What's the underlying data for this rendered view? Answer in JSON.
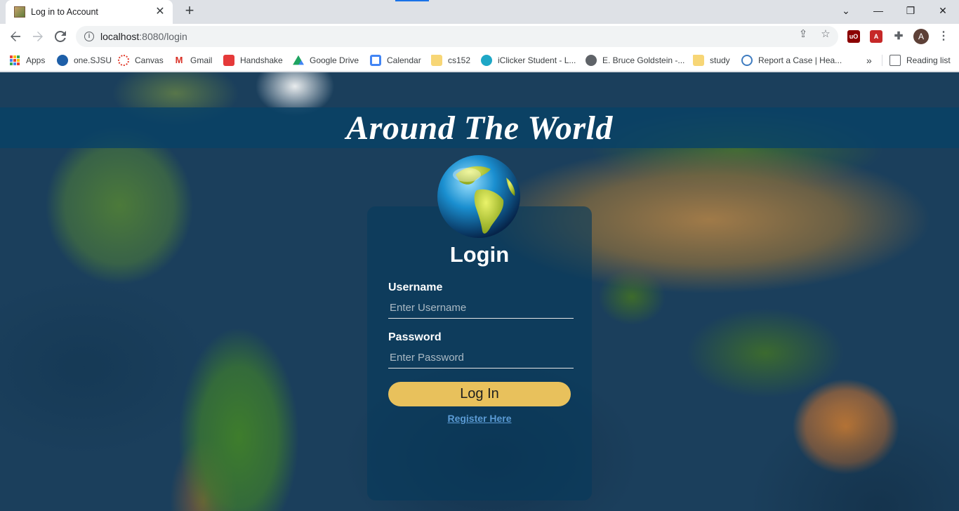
{
  "browser": {
    "tab_title": "Log in to Account",
    "tab_close": "✕",
    "new_tab": "+",
    "window_controls": {
      "collapse": "⌄",
      "minimize": "—",
      "restore": "❐",
      "close": "✕"
    },
    "url_host": "localhost",
    "url_rest": ":8080/login",
    "profile_initial": "A",
    "extensions_menu": "»",
    "reading_list": "Reading list"
  },
  "bookmarks": [
    {
      "label": "Apps",
      "icon": "apps-grid-icon"
    },
    {
      "label": "one.SJSU",
      "icon": "sjsu-icon",
      "color": "#1e5fa8"
    },
    {
      "label": "Canvas",
      "icon": "canvas-icon",
      "color": "#e23c2d"
    },
    {
      "label": "Gmail",
      "icon": "gmail-icon",
      "color": "#d93025"
    },
    {
      "label": "Handshake",
      "icon": "handshake-icon",
      "color": "#e53a3a"
    },
    {
      "label": "Google Drive",
      "icon": "drive-icon",
      "color": "#1fa463"
    },
    {
      "label": "Calendar",
      "icon": "calendar-icon",
      "color": "#4285f4"
    },
    {
      "label": "cs152",
      "icon": "folder-icon",
      "color": "#f7d676"
    },
    {
      "label": "iClicker Student - L...",
      "icon": "iclicker-icon",
      "color": "#1ea7c6"
    },
    {
      "label": "E. Bruce Goldstein -...",
      "icon": "globe-icon",
      "color": "#5f6368"
    },
    {
      "label": "study",
      "icon": "folder-icon",
      "color": "#f7d676"
    },
    {
      "label": "Report a Case | Hea...",
      "icon": "report-icon",
      "color": "#3f7cc0"
    }
  ],
  "page": {
    "banner_title": "Around The World",
    "login_heading": "Login",
    "username_label": "Username",
    "username_placeholder": "Enter Username",
    "password_label": "Password",
    "password_placeholder": "Enter Password",
    "login_button": "Log In",
    "register_link": "Register Here"
  },
  "colors": {
    "button": "#e8c15c",
    "register_link": "#5b9bd5",
    "banner": "#084266"
  }
}
